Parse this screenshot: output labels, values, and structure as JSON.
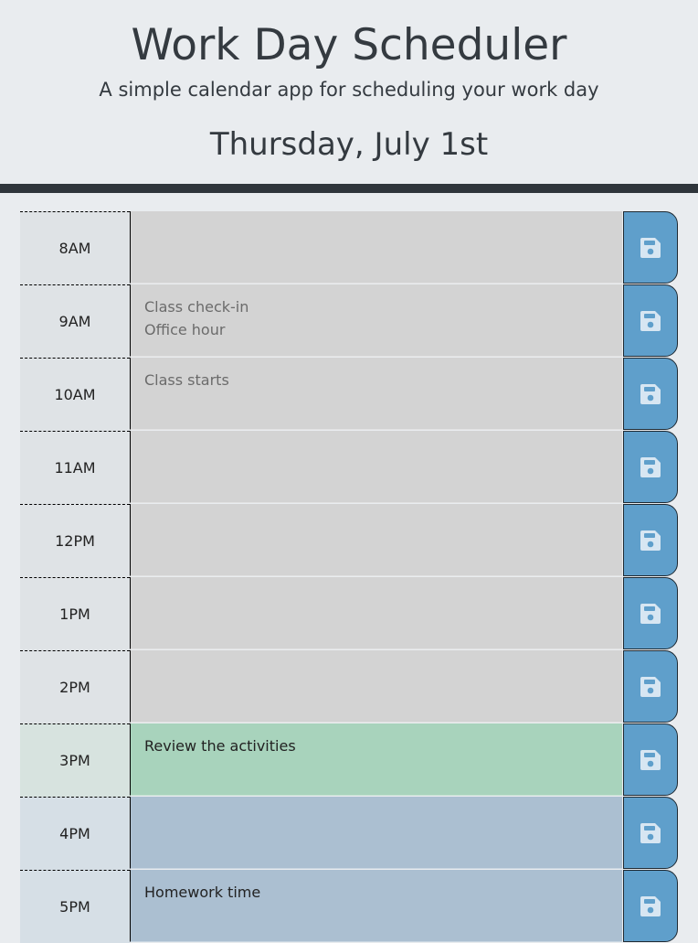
{
  "header": {
    "title": "Work Day Scheduler",
    "subtitle": "A simple calendar app for scheduling your work day",
    "current_day": "Thursday, July 1st"
  },
  "colors": {
    "past": "#d3d3d3",
    "present": "#a8d3bc",
    "future": "#abbfd1",
    "save_button": "#5f9fcb"
  },
  "time_blocks": [
    {
      "hour": "8AM",
      "text": "",
      "state": "past"
    },
    {
      "hour": "9AM",
      "text": "Class check-in\nOffice hour",
      "state": "past"
    },
    {
      "hour": "10AM",
      "text": "Class starts",
      "state": "past"
    },
    {
      "hour": "11AM",
      "text": "",
      "state": "past"
    },
    {
      "hour": "12PM",
      "text": "",
      "state": "past"
    },
    {
      "hour": "1PM",
      "text": "",
      "state": "past"
    },
    {
      "hour": "2PM",
      "text": "",
      "state": "past"
    },
    {
      "hour": "3PM",
      "text": "Review the activities",
      "state": "present"
    },
    {
      "hour": "4PM",
      "text": "",
      "state": "future"
    },
    {
      "hour": "5PM",
      "text": "Homework time",
      "state": "future"
    }
  ],
  "save_icon": "floppy-disk-icon"
}
